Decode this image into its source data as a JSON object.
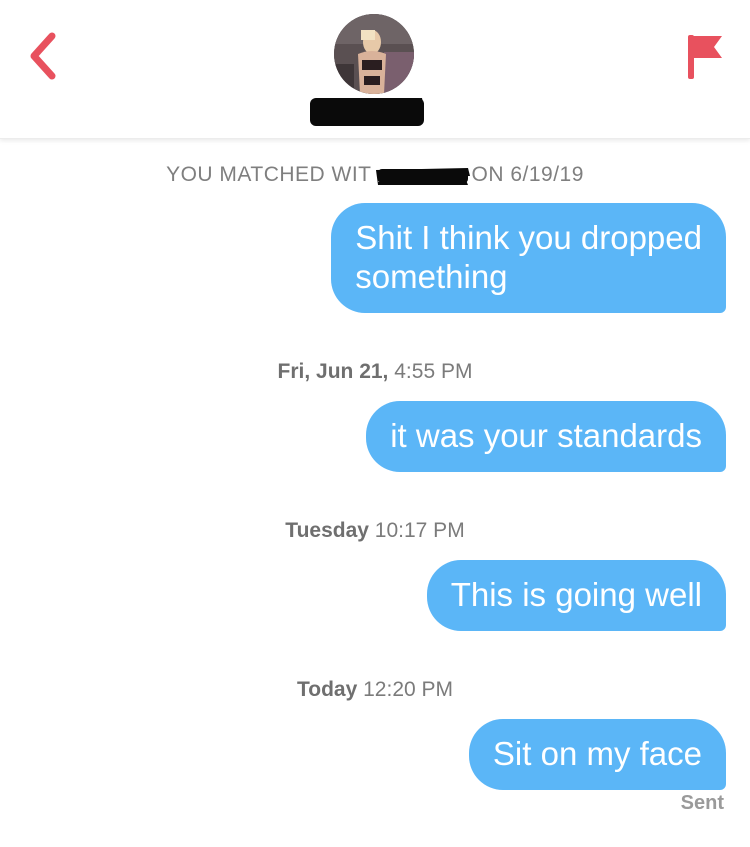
{
  "header": {
    "back_icon": "chevron-left-icon",
    "flag_icon": "flag-icon",
    "accent_color": "#e8515e"
  },
  "conversation": {
    "match_prefix": "YOU MATCHED WIT",
    "match_suffix": "ON 6/19/19",
    "items": [
      {
        "type": "message",
        "text_line1": "Shit I think you dropped",
        "text_line2": "something"
      },
      {
        "type": "timestamp",
        "day": "Fri, Jun 21,",
        "time": "4:55 PM"
      },
      {
        "type": "message",
        "text": "it was your standards"
      },
      {
        "type": "timestamp",
        "day": "Tuesday",
        "time": "10:17 PM"
      },
      {
        "type": "message",
        "text": "This is going well"
      },
      {
        "type": "timestamp",
        "day": "Today",
        "time": "12:20 PM"
      },
      {
        "type": "message",
        "text": "Sit on my face"
      }
    ],
    "status": "Sent",
    "bubble_color": "#5bb6f7"
  }
}
